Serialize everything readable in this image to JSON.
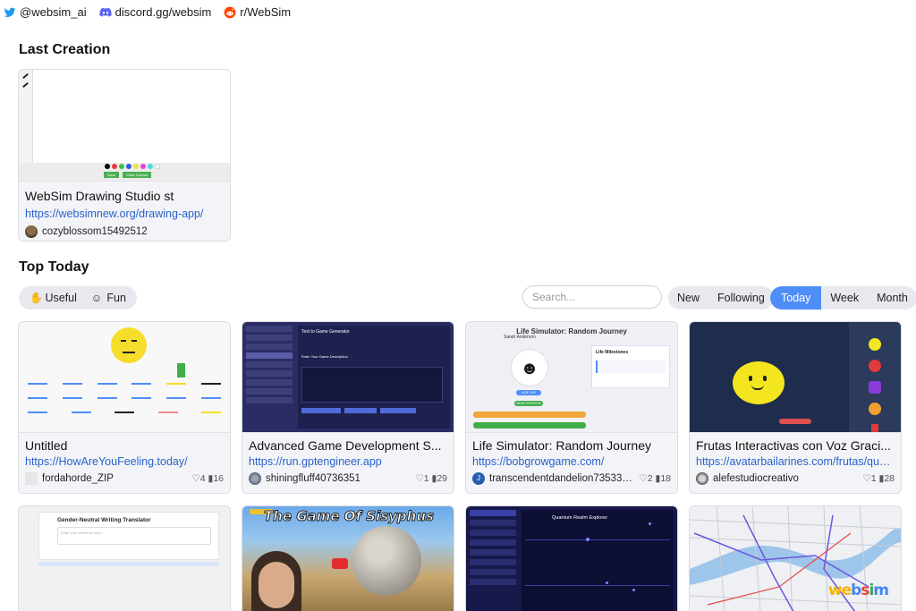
{
  "social": {
    "twitter": "@websim_ai",
    "discord": "discord.gg/websim",
    "reddit": "r/WebSim"
  },
  "last_creation": {
    "heading": "Last Creation",
    "card": {
      "title": "WebSim Drawing Studio st",
      "url": "https://websimnew.org/drawing-app/",
      "author": "cozyblossom15492512",
      "thumb_buttons": [
        "Save",
        "Clear Canvas"
      ]
    }
  },
  "top_today": {
    "heading": "Top Today",
    "categories": [
      {
        "label": "Useful",
        "icon": "muscle-icon"
      },
      {
        "label": "Fun",
        "icon": "clown-icon"
      }
    ],
    "search_placeholder": "Search...",
    "sort_tabs": [
      "New",
      "Following"
    ],
    "time_tabs": [
      "Today",
      "Week",
      "Month"
    ],
    "active_time_tab": "Today"
  },
  "cards": [
    {
      "title": "Untitled",
      "url": "https://HowAreYouFeeling.today/",
      "author": "fordahorde_ZIP",
      "likes": "4",
      "views": "16"
    },
    {
      "title": "Advanced Game Development S...",
      "url": "https://run.gptengineer.app",
      "author": "shiningfluff40736351",
      "likes": "1",
      "views": "29",
      "thumb_heading": "Text to Game Generator",
      "thumb_subheading": "Enter Your Game Description"
    },
    {
      "title": "Life Simulator: Random Journey",
      "url": "https://bobgrowgame.com/",
      "author": "transcendentdandelion73533838",
      "avatar_letter": "J",
      "likes": "2",
      "views": "18",
      "thumb_heading": "Life Simulator: Random Journey",
      "thumb_subheading": "Sarah Anderson",
      "thumb_panel": "Life Milestones",
      "thumb_button_1": "AGE UP!",
      "thumb_button_2": "NEW PERSON"
    },
    {
      "title": "Frutas Interactivas con Voz Graci...",
      "url": "https://avatarbailarines.com/frutas/que la",
      "author": "alefestudiocreativo",
      "likes": "1",
      "views": "28"
    },
    {
      "title": "Gender-Neutral Writing Translator",
      "thumb_heading": "Gender-Neutral Writing Translator",
      "thumb_placeholder": "Enter your sentence here..."
    },
    {
      "title": "The Game Of Sisyphus",
      "thumb_heading": "The Game Of Sisyphus"
    },
    {
      "title": "Quantum Realm Explorer",
      "thumb_heading": "Quantum Realm Explorer"
    },
    {
      "title": "City map",
      "watermark": "websim"
    }
  ],
  "colors": {
    "accent": "#4f8ef7",
    "link": "#2a62c9",
    "card_bg": "#f3f4f8"
  }
}
